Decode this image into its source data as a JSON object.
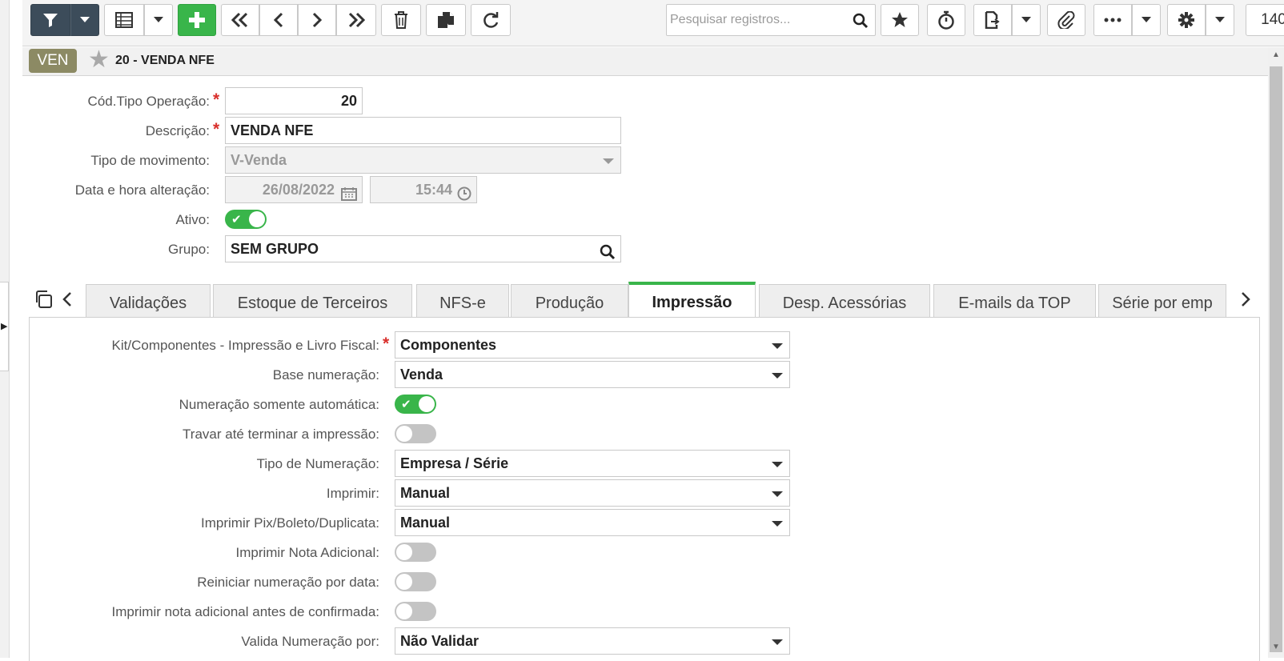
{
  "toolbar": {
    "search_placeholder": "Pesquisar registros...",
    "record_counter": "140",
    "icons": [
      "filter-icon",
      "grid-icon",
      "add-icon",
      "first-icon",
      "previous-icon",
      "next-icon",
      "last-icon",
      "delete-icon",
      "copy-icon",
      "refresh-icon",
      "search-icon",
      "star-icon",
      "timer-icon",
      "export-icon",
      "attach-icon",
      "more-icon",
      "gear-icon"
    ],
    "accent_green": "#39b54a",
    "dark_button": "#3c4c5a"
  },
  "record": {
    "badge": "VEN",
    "title": "20 - VENDA NFE",
    "badge_color": "#8c8a64"
  },
  "header_form": {
    "cod_tipo_operacao": {
      "label": "Cód.Tipo Operação:",
      "value": "20",
      "required": true
    },
    "descricao": {
      "label": "Descrição:",
      "value": "VENDA NFE",
      "required": true
    },
    "tipo_movimento": {
      "label": "Tipo de movimento:",
      "value": "V-Venda"
    },
    "data_hora": {
      "label": "Data e hora alteração:",
      "date": "26/08/2022",
      "time": "15:44"
    },
    "ativo": {
      "label": "Ativo:",
      "value": true
    },
    "grupo": {
      "label": "Grupo:",
      "value": "SEM GRUPO"
    }
  },
  "tabs": [
    {
      "label": "Validações",
      "active": false
    },
    {
      "label": "Estoque de Terceiros",
      "active": false
    },
    {
      "label": "NFS-e",
      "active": false
    },
    {
      "label": "Produção",
      "active": false
    },
    {
      "label": "Impressão",
      "active": true
    },
    {
      "label": "Desp. Acessórias",
      "active": false
    },
    {
      "label": "E-mails da TOP",
      "active": false
    },
    {
      "label": "Série por emp",
      "active": false
    }
  ],
  "impressao": {
    "kit_componentes": {
      "label": "Kit/Componentes - Impressão e Livro Fiscal:",
      "value": "Componentes",
      "required": true
    },
    "base_numeracao": {
      "label": "Base numeração:",
      "value": "Venda"
    },
    "numeracao_auto": {
      "label": "Numeração somente automática:",
      "value": true
    },
    "travar_impressao": {
      "label": "Travar até terminar a impressão:",
      "value": false
    },
    "tipo_numeracao": {
      "label": "Tipo de Numeração:",
      "value": "Empresa / Série"
    },
    "imprimir": {
      "label": "Imprimir:",
      "value": "Manual"
    },
    "imprimir_pix": {
      "label": "Imprimir Pix/Boleto/Duplicata:",
      "value": "Manual"
    },
    "imprimir_nota_adicional": {
      "label": "Imprimir Nota Adicional:",
      "value": false
    },
    "reiniciar_numeracao": {
      "label": "Reiniciar numeração por data:",
      "value": false
    },
    "imprimir_antes_confirmada": {
      "label": "Imprimir nota adicional antes de confirmada:",
      "value": false
    },
    "valida_numeracao": {
      "label": "Valida Numeração por:",
      "value": "Não Validar"
    }
  }
}
